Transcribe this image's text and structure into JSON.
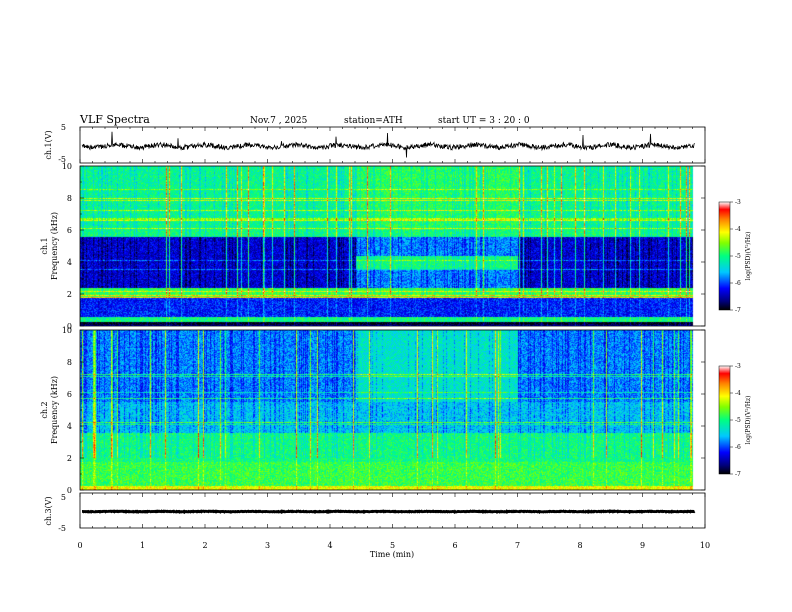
{
  "header": {
    "title": "VLF  Spectra",
    "date": "Nov.7  , 2025",
    "station": "station=ATH",
    "start": "start  UT  =    3  : 20 : 0"
  },
  "chart_data": [
    {
      "type": "line",
      "ylabel": "ch.1(V)",
      "yticks": [
        "5",
        "-5"
      ],
      "ylim": [
        -5,
        5
      ],
      "xlim": [
        0,
        10
      ],
      "baseline": -0.3,
      "trace_end": 9.8,
      "color": "#000000"
    },
    {
      "type": "heatmap",
      "ylabel_channel": "ch.1",
      "ylabel": "Frequency  (kHz)",
      "yticks": [
        "0",
        "2",
        "4",
        "6",
        "8",
        "10"
      ],
      "ylim": [
        0,
        10
      ],
      "xlim": [
        0,
        10
      ],
      "data_extent_min": 9.8,
      "colorbar": {
        "label": "log(PSD)(V²/Hz)",
        "ticks": [
          "-3",
          "-4",
          "-5",
          "-6",
          "-7"
        ],
        "range": [
          -7,
          -3
        ]
      },
      "segments": [
        {
          "start": 0.0,
          "end": 4.4,
          "note": "strong noise band 2.5-5.5 kHz"
        },
        {
          "start": 4.4,
          "end": 7.0,
          "note": "weaker noise band 3.5-4.5 kHz"
        },
        {
          "start": 7.0,
          "end": 9.8,
          "note": "strong noise band 2.5-5.5 kHz"
        }
      ]
    },
    {
      "type": "heatmap",
      "ylabel_channel": "ch.2",
      "ylabel": "Frequency  (kHz)",
      "yticks": [
        "0",
        "2",
        "4",
        "6",
        "8",
        "10"
      ],
      "ylim": [
        0,
        10
      ],
      "xlim": [
        0,
        10
      ],
      "data_extent_min": 9.8,
      "colorbar": {
        "label": "log(PSD)(V²/Hz)",
        "ticks": [
          "-3",
          "-4",
          "-5",
          "-6",
          "-7"
        ],
        "range": [
          -7,
          -3
        ]
      }
    },
    {
      "type": "line",
      "ylabel": "ch.3(V)",
      "yticks": [
        "5",
        "-5"
      ],
      "ylim": [
        -5,
        5
      ],
      "xlim": [
        0,
        10
      ],
      "baseline": -0.3,
      "trace_end": 9.8,
      "xlabel": "Time  (min)",
      "xticks": [
        "0",
        "1",
        "2",
        "3",
        "4",
        "5",
        "6",
        "7",
        "8",
        "9",
        "10"
      ],
      "color": "#000000"
    }
  ]
}
